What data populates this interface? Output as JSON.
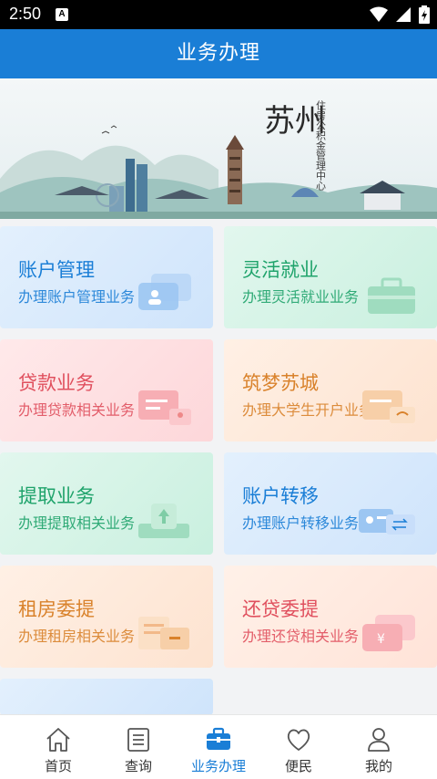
{
  "status_bar": {
    "time": "2:50",
    "notification_icon": "A"
  },
  "header": {
    "title": "业务办理"
  },
  "banner": {
    "city_name": "苏州",
    "org_name": "住房公积金管理中心"
  },
  "cards": [
    {
      "title": "账户管理",
      "subtitle": "办理账户管理业务",
      "color": "#1a7ed6",
      "icon": "id-card-icon"
    },
    {
      "title": "灵活就业",
      "subtitle": "办理灵活就业业务",
      "color": "#1fa36b",
      "icon": "briefcase-icon"
    },
    {
      "title": "贷款业务",
      "subtitle": "办理贷款相关业务",
      "color": "#e0505e",
      "icon": "loan-card-icon"
    },
    {
      "title": "筑梦苏城",
      "subtitle": "办理大学生开户业务",
      "color": "#d9822b",
      "icon": "graduate-card-icon"
    },
    {
      "title": "提取业务",
      "subtitle": "办理提取相关业务",
      "color": "#1fa36b",
      "icon": "withdraw-icon"
    },
    {
      "title": "账户转移",
      "subtitle": "办理账户转移业务",
      "color": "#1a7ed6",
      "icon": "transfer-icon"
    },
    {
      "title": "租房委提",
      "subtitle": "办理租房相关业务",
      "color": "#d9822b",
      "icon": "rent-icon"
    },
    {
      "title": "还贷委提",
      "subtitle": "办理还贷相关业务",
      "color": "#e0505e",
      "icon": "repay-icon"
    }
  ],
  "tabs": [
    {
      "label": "首页",
      "icon": "home-icon"
    },
    {
      "label": "查询",
      "icon": "document-icon"
    },
    {
      "label": "业务办理",
      "icon": "briefcase-icon"
    },
    {
      "label": "便民",
      "icon": "heart-icon"
    },
    {
      "label": "我的",
      "icon": "person-icon"
    }
  ],
  "active_tab": "业务办理"
}
